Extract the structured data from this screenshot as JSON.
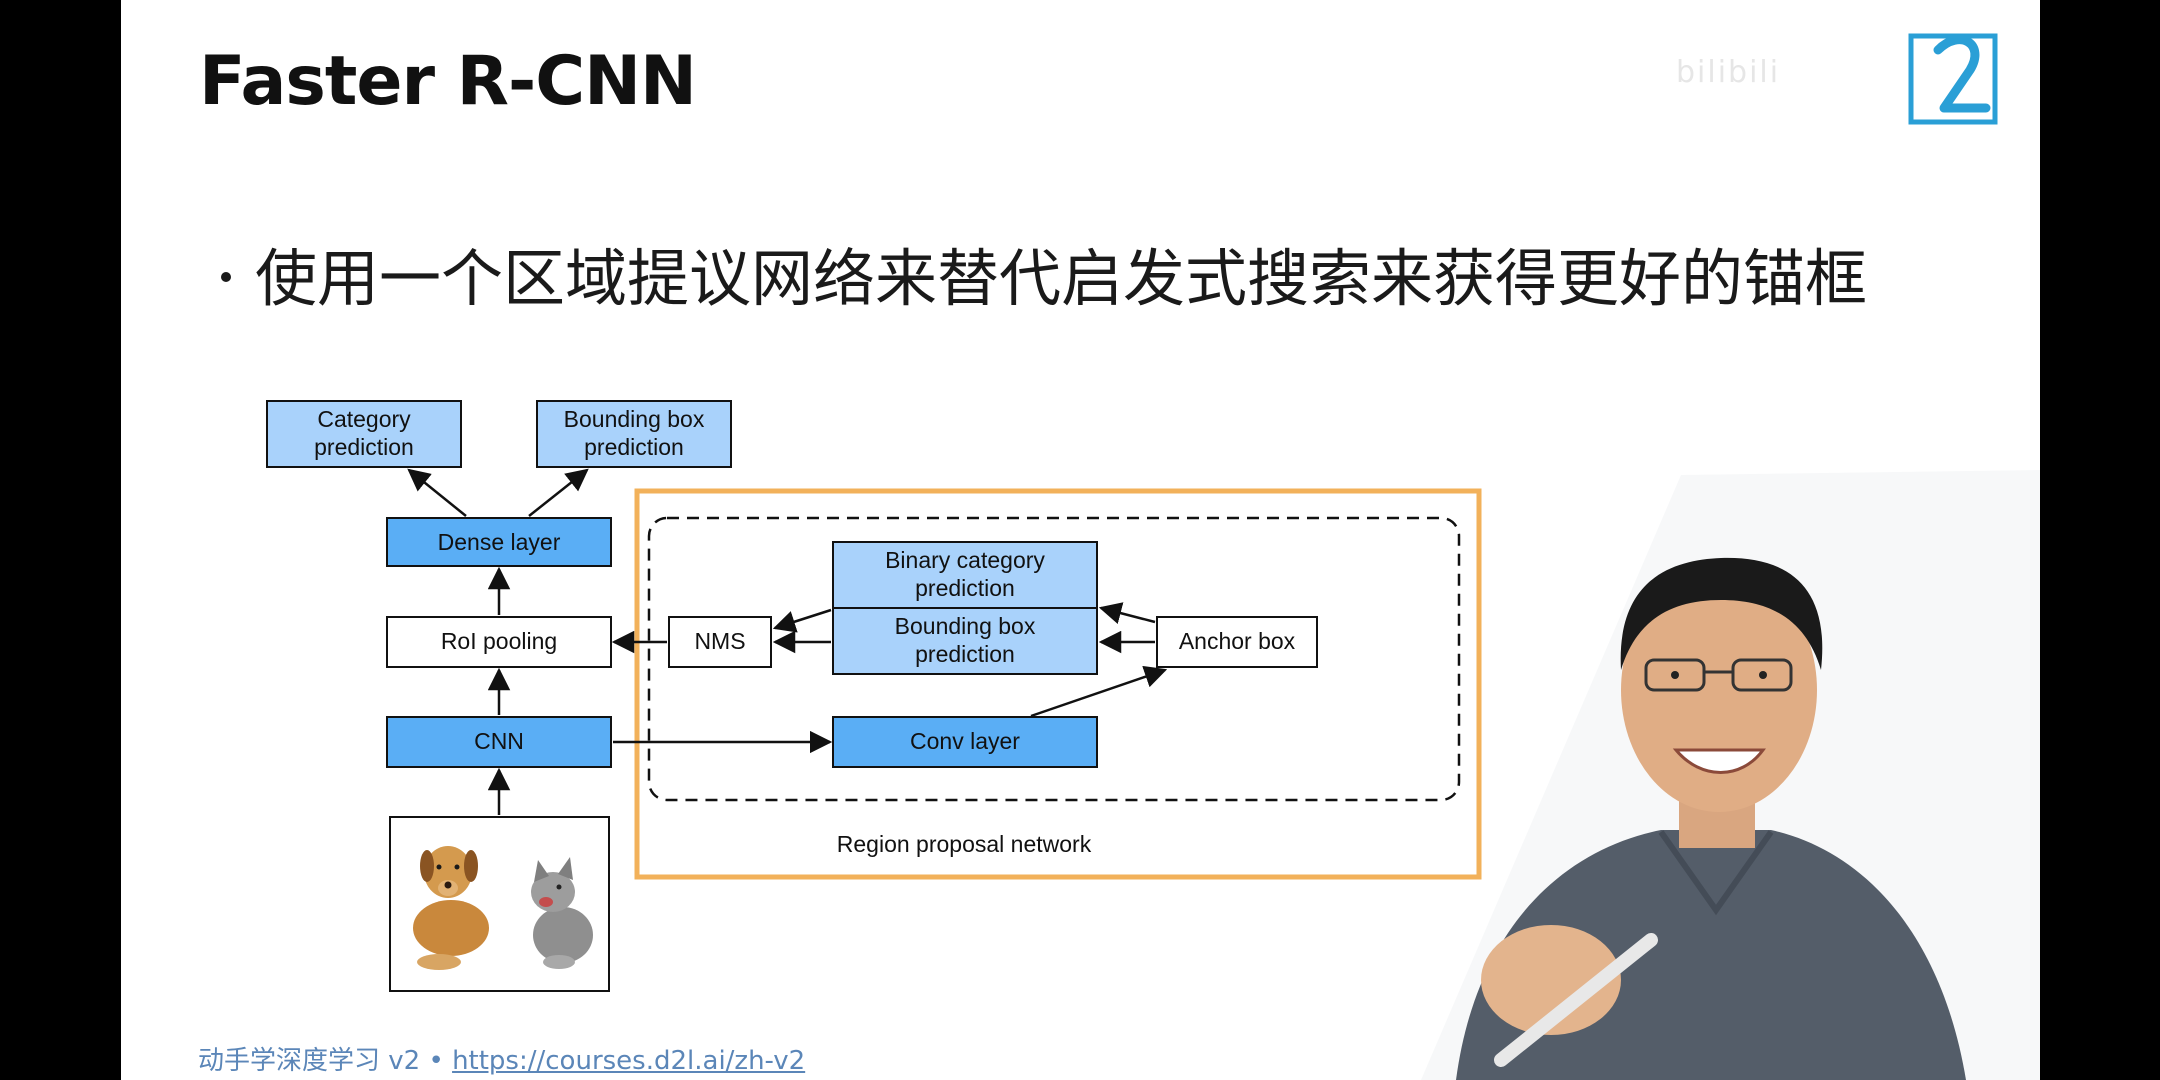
{
  "slide": {
    "title": "Faster R-CNN",
    "bullet": "使用一个区域提议网络来替代启发式搜索来获得更好的锚框",
    "footer_prefix": "动手学深度学习 v2 • ",
    "footer_link": "https://courses.d2l.ai/zh-v2",
    "watermark": "bilibili"
  },
  "diagram": {
    "category_prediction": [
      "Category",
      "prediction"
    ],
    "bbox_prediction_top": [
      "Bounding box",
      "prediction"
    ],
    "dense_layer": "Dense layer",
    "roi_pooling": "RoI pooling",
    "cnn": "CNN",
    "nms": "NMS",
    "binary_category": [
      "Binary category",
      "prediction"
    ],
    "bbox_prediction_rpn": [
      "Bounding box",
      "prediction"
    ],
    "anchor_box": "Anchor box",
    "conv_layer": "Conv layer",
    "rpn_label": "Region proposal network"
  },
  "colors": {
    "dark_blue_box": "#5aaef5",
    "light_blue_box": "#a9d2fb",
    "orange_frame": "#f2b15a",
    "footer_link": "#5b86b8"
  }
}
